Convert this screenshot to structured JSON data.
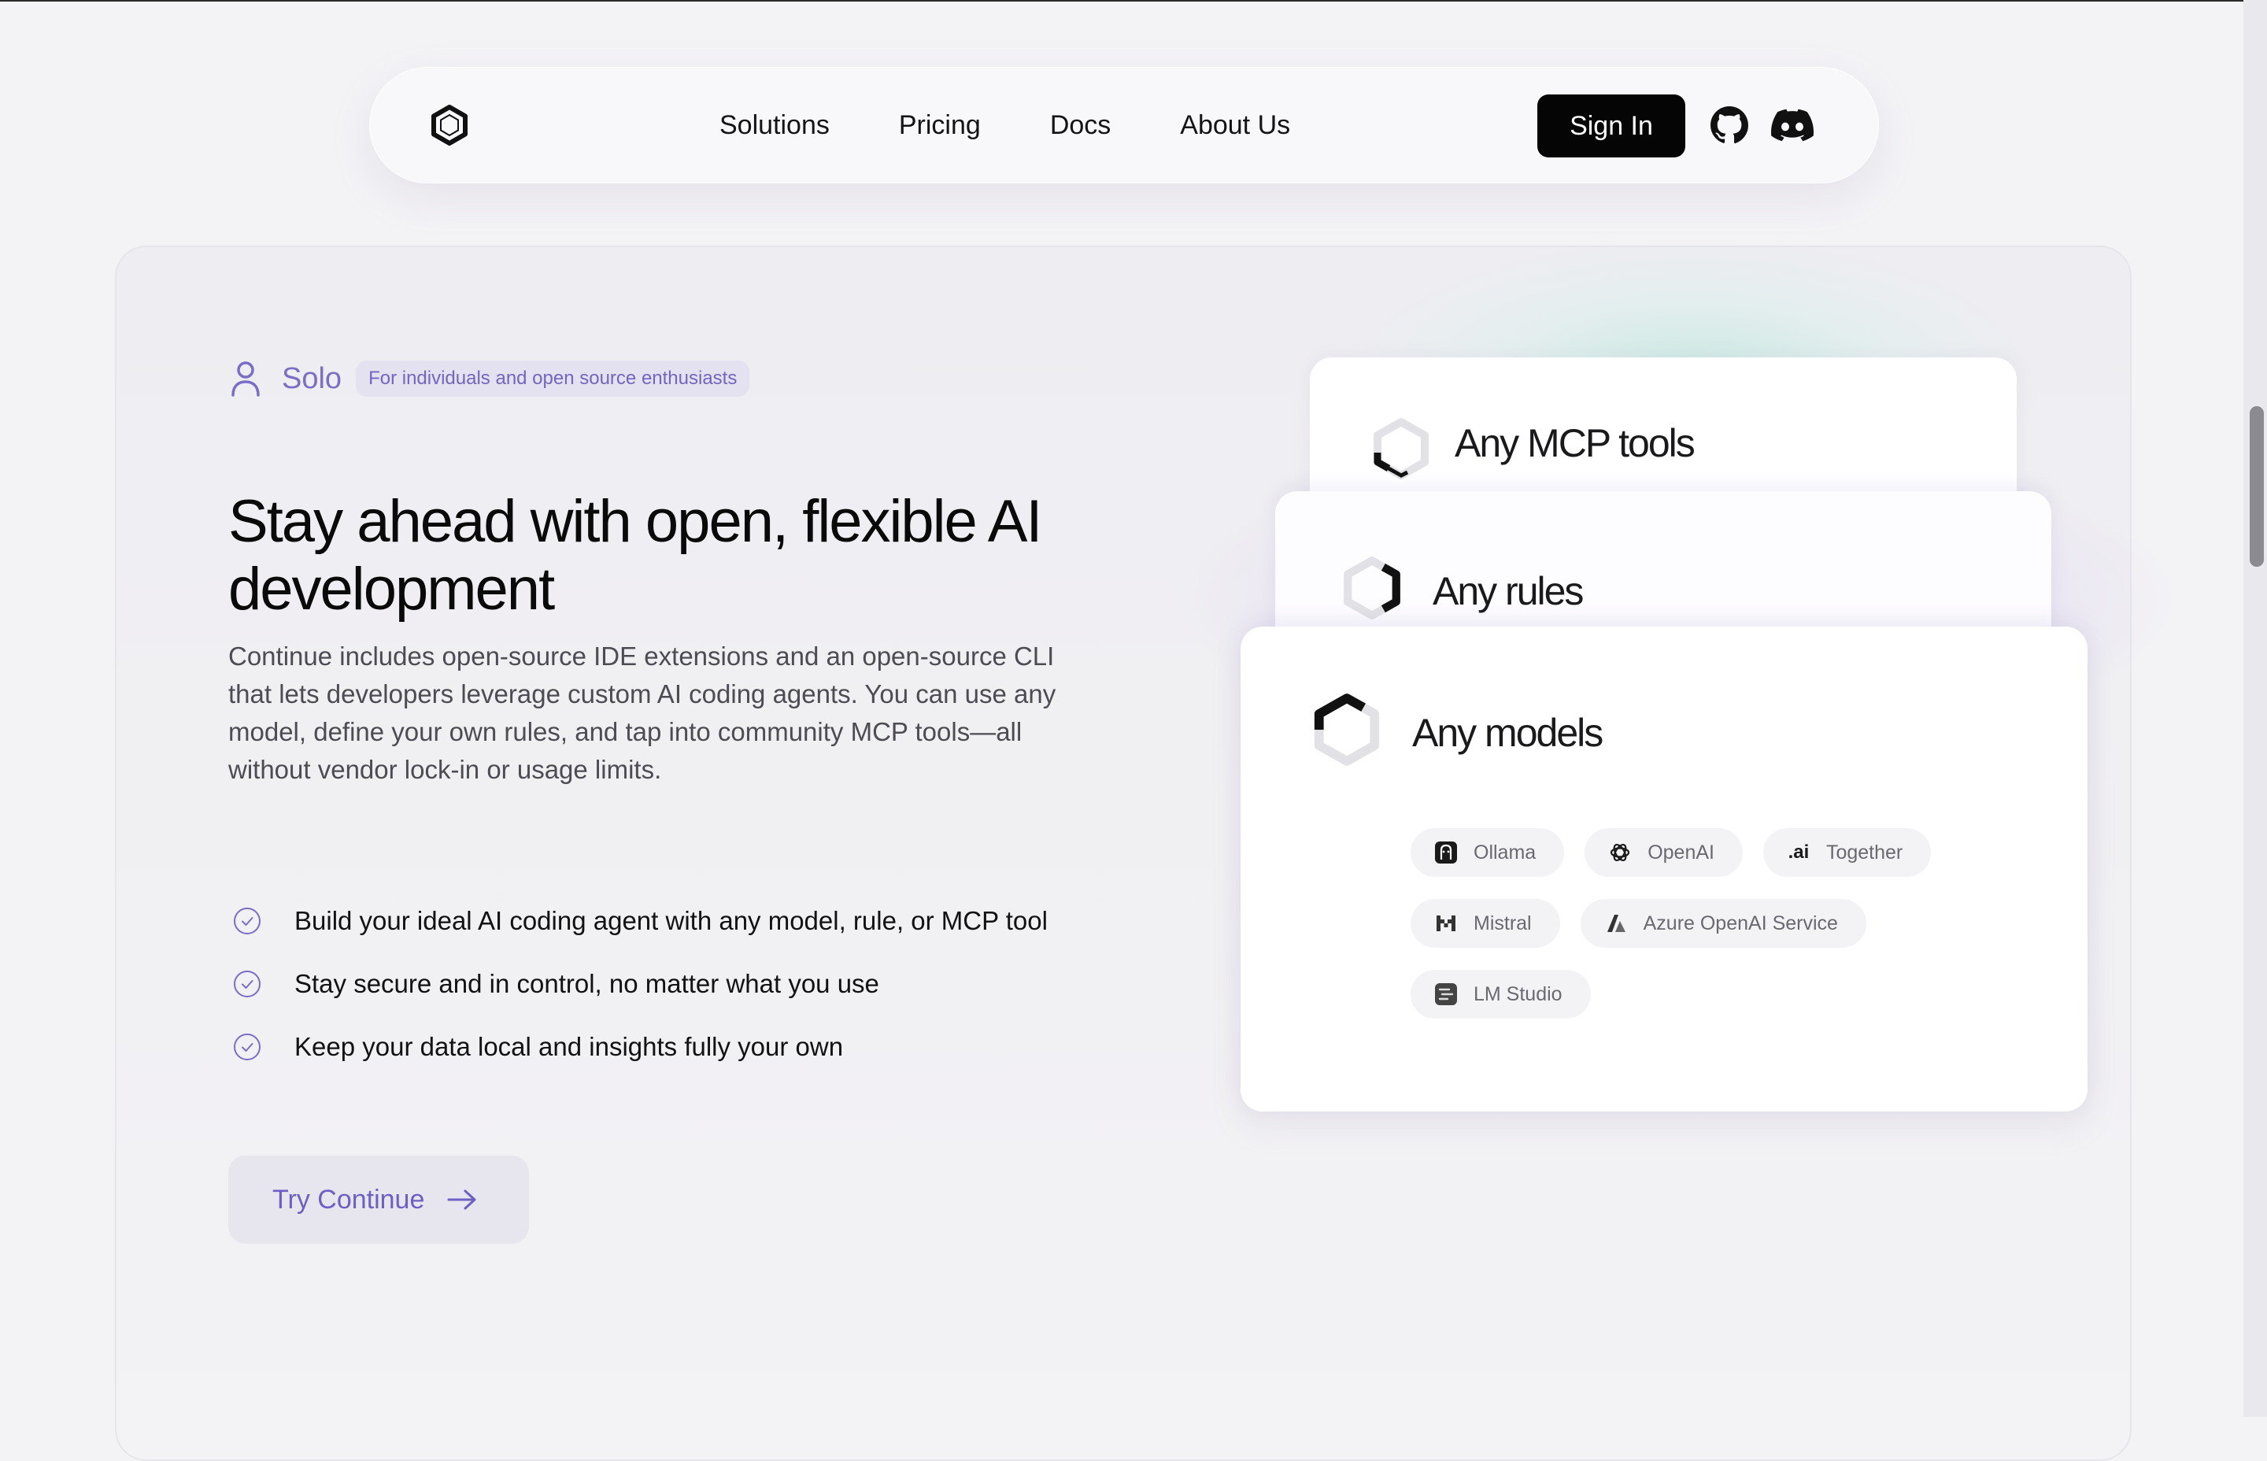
{
  "nav": {
    "links": [
      "Solutions",
      "Pricing",
      "Docs",
      "About Us"
    ],
    "sign_in": "Sign In"
  },
  "hero": {
    "tier_label": "Solo",
    "tier_pill": "For individuals and open source enthusiasts",
    "headline": "Stay ahead with open, flexible  AI development",
    "description": "Continue includes open-source IDE extensions and an open-source CLI that lets developers leverage custom AI coding agents. You can use any model, define your own rules, and tap into community MCP tools—all without vendor lock-in or usage limits.",
    "features": [
      "Build your ideal AI coding agent with any model, rule, or MCP tool",
      "Stay secure and in control, no matter what you use",
      "Keep your data local and insights fully your own"
    ],
    "cta": "Try Continue"
  },
  "cards": {
    "mcp": "Any MCP tools",
    "rules": "Any rules",
    "models": "Any models",
    "providers": [
      {
        "label": "Ollama",
        "icon": "ollama-icon"
      },
      {
        "label": "OpenAI",
        "icon": "openai-icon"
      },
      {
        "label": "Together",
        "icon": "together-icon",
        "mark": ".ai"
      },
      {
        "label": "Mistral",
        "icon": "mistral-icon"
      },
      {
        "label": "Azure OpenAI Service",
        "icon": "azure-icon"
      },
      {
        "label": "LM Studio",
        "icon": "lmstudio-icon"
      }
    ]
  },
  "colors": {
    "accent": "#7a6ec9",
    "button_dark": "#050505",
    "background": "#f3f2f5"
  }
}
